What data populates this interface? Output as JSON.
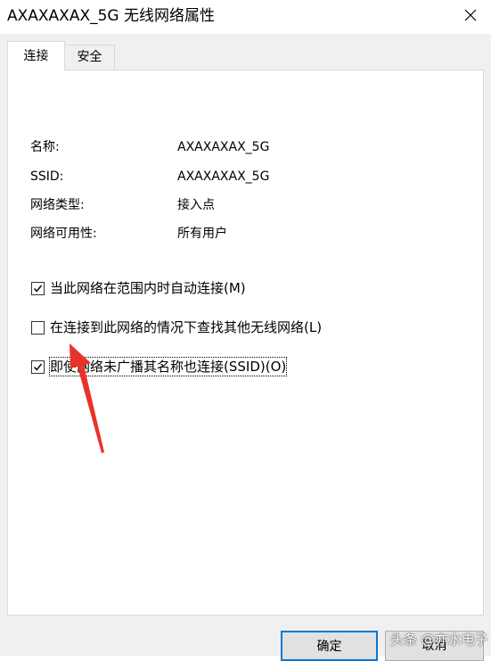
{
  "window": {
    "title": "AXAXAXAX_5G 无线网络属性",
    "close_icon": "close-icon"
  },
  "tabs": [
    {
      "label": "连接",
      "active": true
    },
    {
      "label": "安全",
      "active": false
    }
  ],
  "properties": [
    {
      "label": "名称:",
      "value": "AXAXAXAX_5G"
    },
    {
      "label": "SSID:",
      "value": "AXAXAXAX_5G"
    },
    {
      "label": "网络类型:",
      "value": "接入点"
    },
    {
      "label": "网络可用性:",
      "value": "所有用户"
    }
  ],
  "options": [
    {
      "label": "当此网络在范围内时自动连接(M)",
      "checked": true
    },
    {
      "label": "在连接到此网络的情况下查找其他无线网络(L)",
      "checked": false
    },
    {
      "label": "即使网络未广播其名称也连接(SSID)(O)",
      "checked": true
    }
  ],
  "buttons": {
    "ok_label": "确定",
    "cancel_label": "取消"
  },
  "watermark": "头条 @亦水电子",
  "colors": {
    "arrow": "#e8332a",
    "focus_border": "#0078d7",
    "dialog_background": "#f0f0f0"
  }
}
